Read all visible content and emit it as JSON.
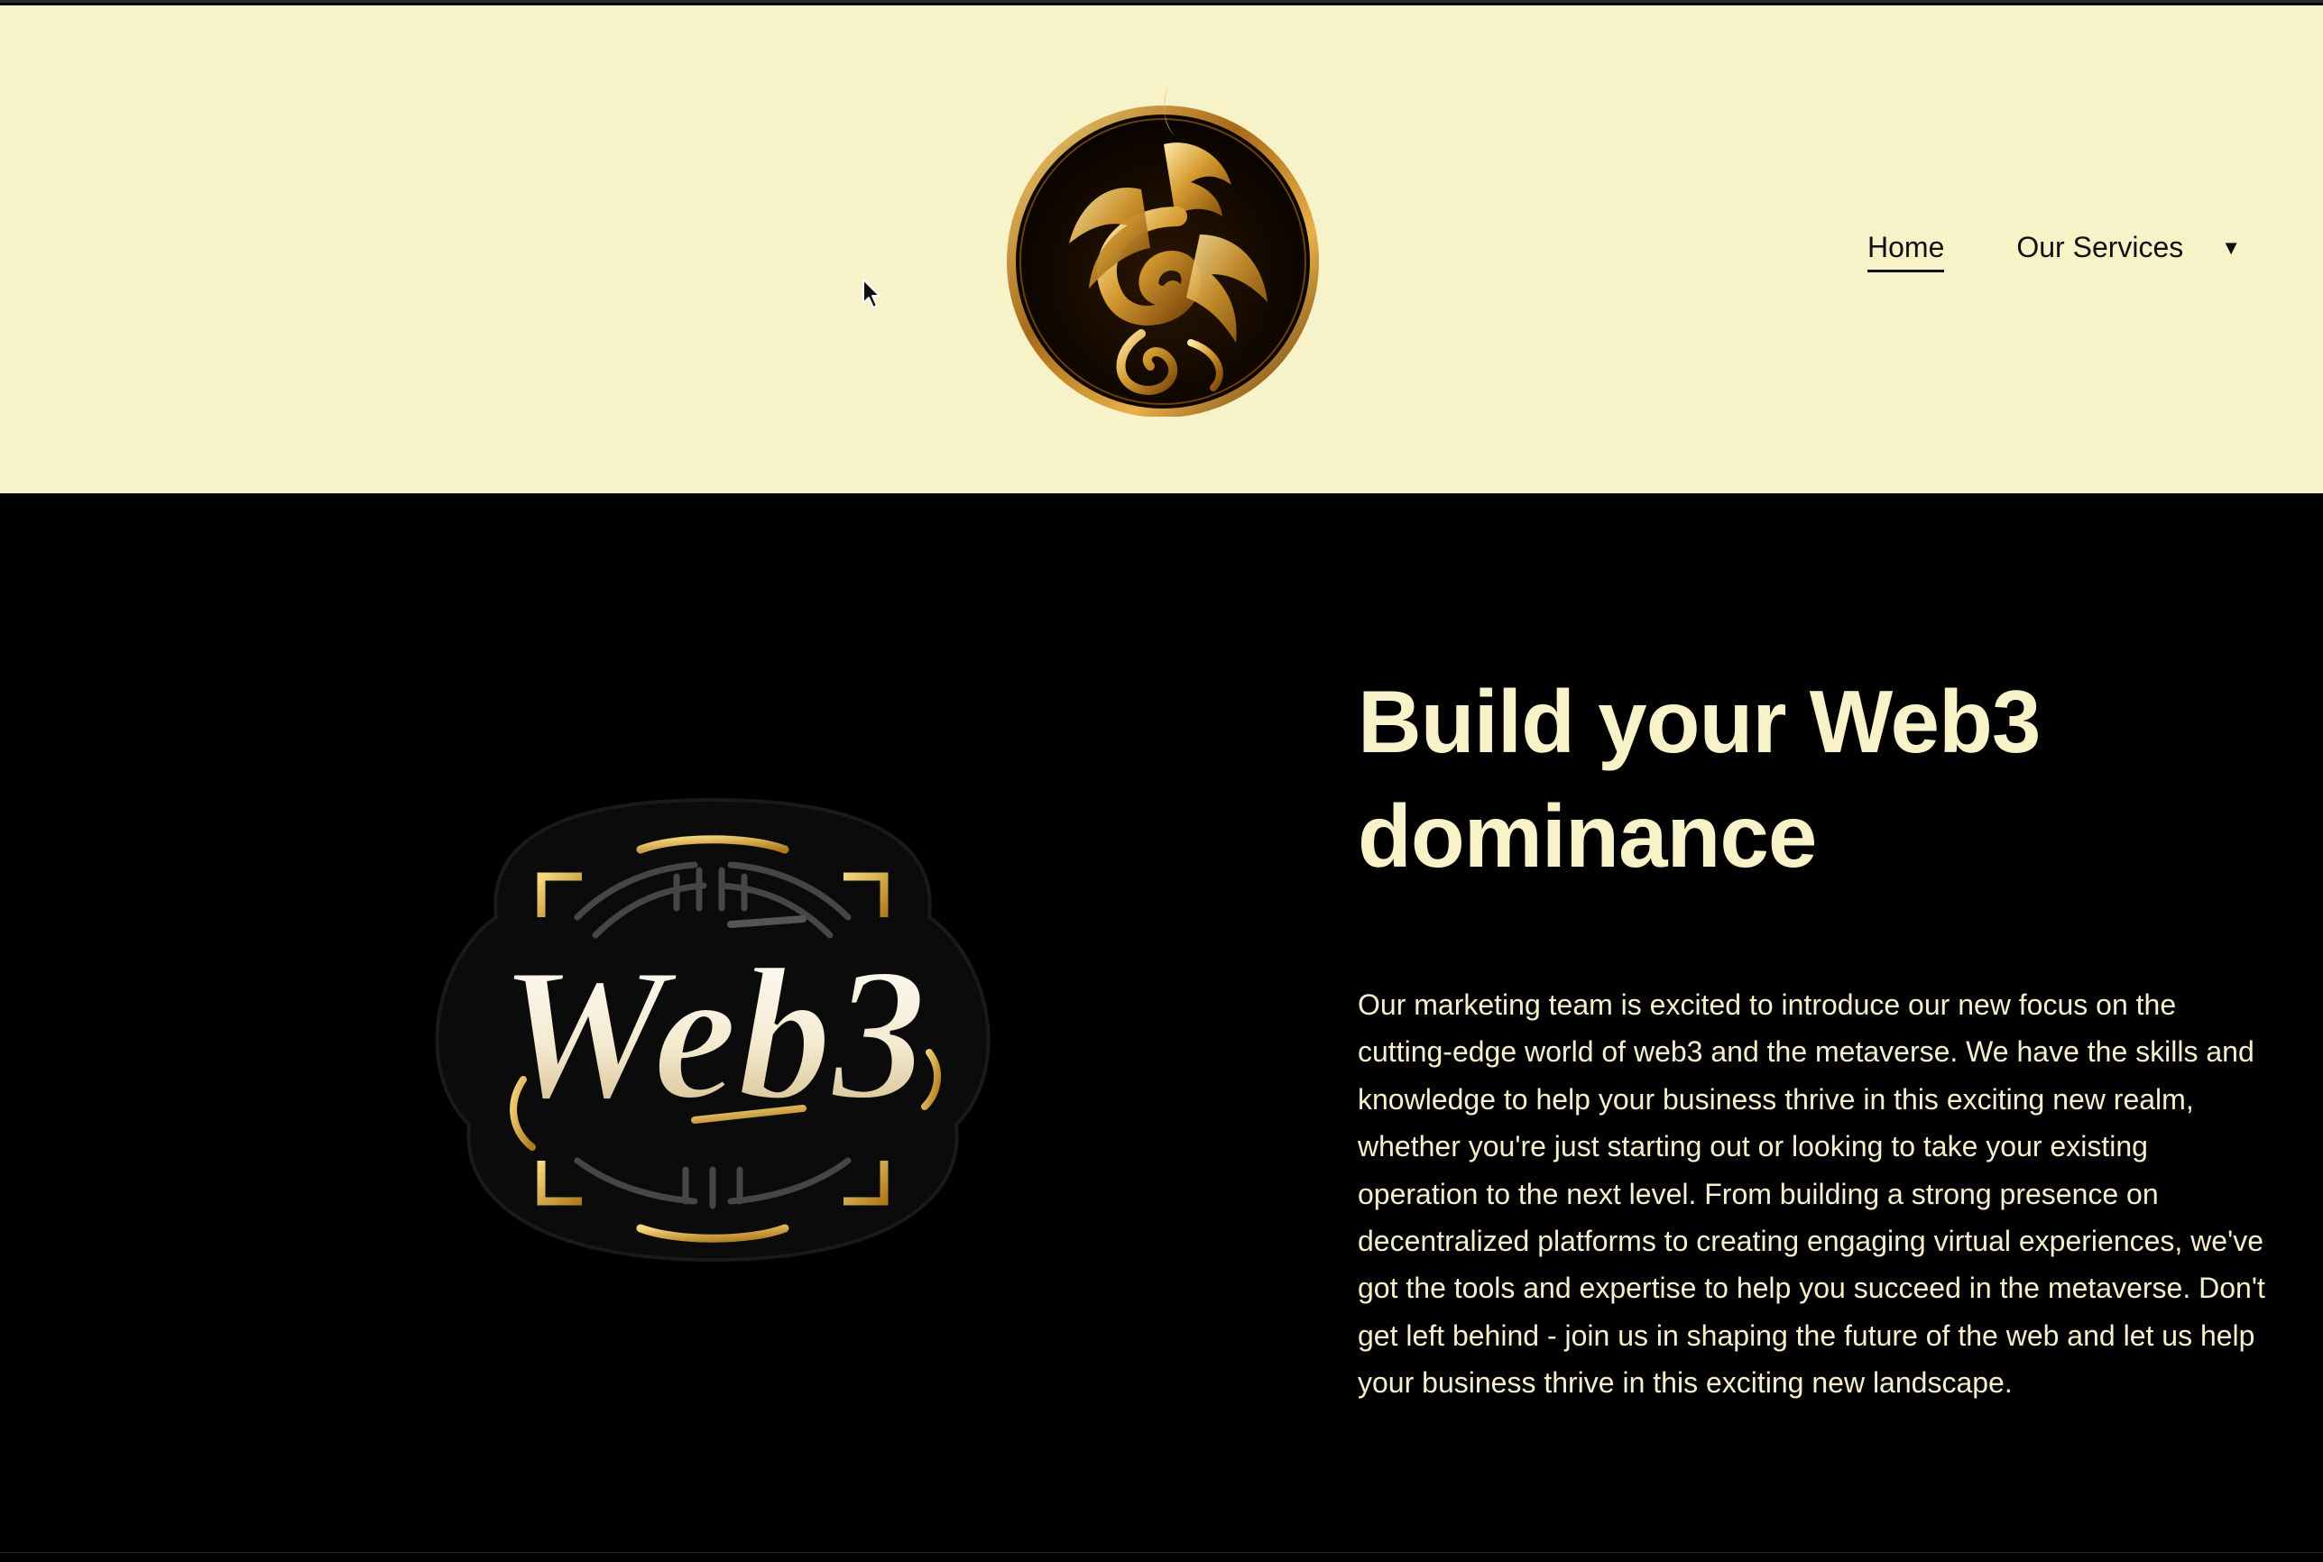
{
  "header": {
    "logo_name": "golden dragon emblem",
    "nav": {
      "home_label": "Home",
      "services_label": "Our Services",
      "services_caret": "▼"
    }
  },
  "hero": {
    "image_text": "Web3",
    "title": "Build your Web3 dominance",
    "body": "Our marketing team is excited to introduce our new focus on the cutting-edge world of web3 and the metaverse. We have the skills and knowledge to help your business thrive in this exciting new realm, whether you're just starting out or looking to take your existing operation to the next level. From building a strong presence on decentralized platforms to creating engaging virtual experiences, we've got the tools and expertise to help you succeed in the metaverse. Don't get left behind - join us in shaping the future of the web and let us help your business thrive in this exciting new landscape."
  },
  "colors": {
    "header_bg": "#f8f2c8",
    "hero_bg": "#000000",
    "hero_title": "#f8f2c8",
    "gold": "#c9962a"
  }
}
